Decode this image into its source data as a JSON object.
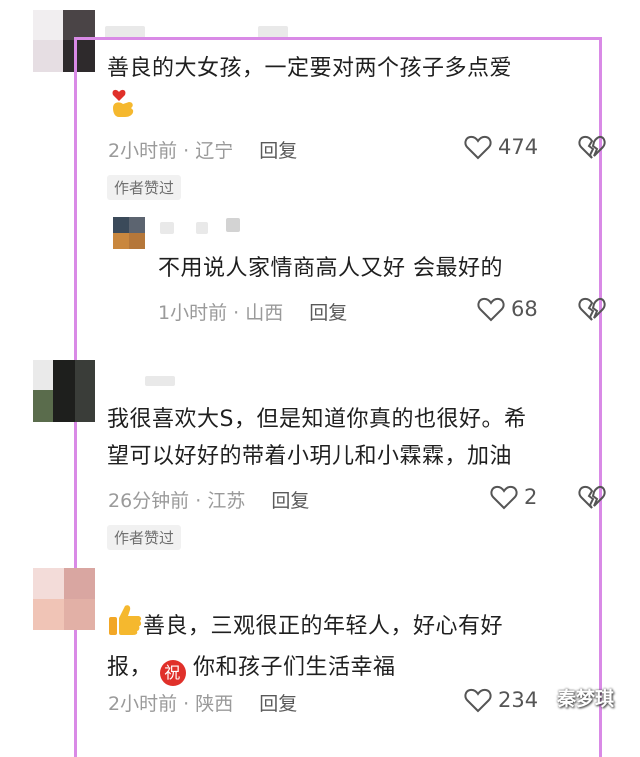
{
  "comments": [
    {
      "text_lines": [
        "善良的大女孩，一定要对两个孩子多点爱"
      ],
      "time": "2小时前",
      "location": "辽宁",
      "reply_label": "回复",
      "likes": "474",
      "badge": "作者赞过"
    },
    {
      "text_lines": [
        "不用说人家情商高人又好 会最好的"
      ],
      "time": "1小时前",
      "location": "山西",
      "reply_label": "回复",
      "likes": "68"
    },
    {
      "text_lines": [
        "我很喜欢大S，但是知道你真的也很好。希",
        "望可以好好的带着小玥儿和小霖霖，加油"
      ],
      "time": "26分钟前",
      "location": "江苏",
      "reply_label": "回复",
      "likes": "2",
      "badge": "作者赞过"
    },
    {
      "text_lines": [
        "善良，三观很正的年轻人，好心有好",
        "报，",
        "你和孩子们生活幸福"
      ],
      "time": "2小时前",
      "location": "陕西",
      "reply_label": "回复",
      "likes": "234"
    }
  ],
  "separator": " · ",
  "emoji_names": [
    "heart-hand-emoji",
    "thumbs-up-emoji",
    "congrats-emoji"
  ],
  "emoji_congrats_char": "祝",
  "watermark": "秦梦琪",
  "colors": {
    "frame": "#d98ae6",
    "meta": "#9a9a9a",
    "emoji_red": "#e0302a",
    "emoji_yellow": "#f5b82e"
  }
}
